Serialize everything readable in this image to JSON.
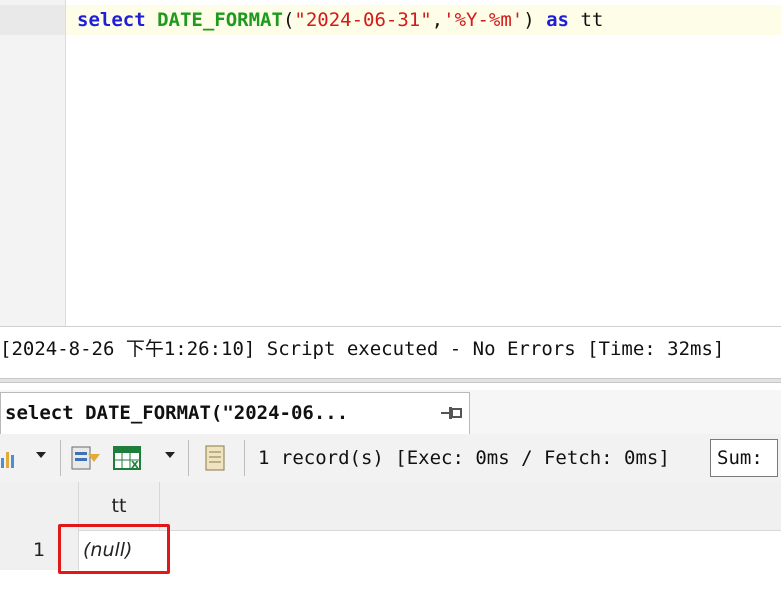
{
  "editor": {
    "tokens": {
      "select": "select",
      "function": "DATE_FORMAT",
      "open_paren": "(",
      "arg1": "\"2024-06-31\"",
      "comma": ",",
      "arg2": "'%Y-%m'",
      "close_paren": ")",
      "as": "as",
      "alias": "tt"
    }
  },
  "message": {
    "text": "[2024-8-26 下午1:26:10] Script executed - No Errors [Time: 32ms]"
  },
  "result_tab": {
    "label": "select DATE_FORMAT(\"2024-06..."
  },
  "toolbar": {
    "status": "1 record(s) [Exec: 0ms / Fetch: 0ms]",
    "sum_label": "Sum:"
  },
  "grid": {
    "columns": [
      "tt"
    ],
    "rows": [
      {
        "rownum": "1",
        "cells": [
          "(null)"
        ]
      }
    ]
  },
  "colors": {
    "keyword": "#1f1fd6",
    "function": "#1e9a1e",
    "string": "#d41a1a",
    "highlight": "#e01818"
  }
}
